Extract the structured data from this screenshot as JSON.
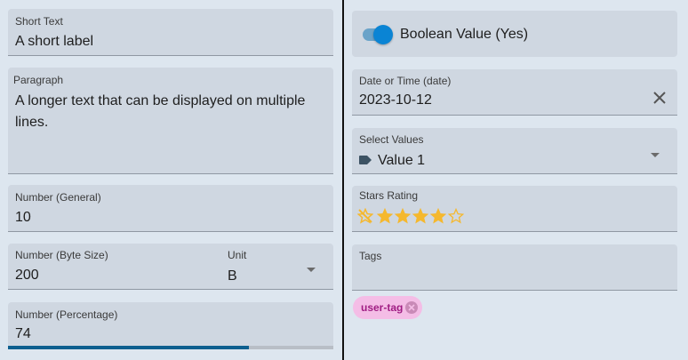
{
  "short_text": {
    "label": "Short Text",
    "value": "A short label"
  },
  "paragraph": {
    "label": "Paragraph",
    "value": "A longer text that can be displayed on multiple lines."
  },
  "number_general": {
    "label": "Number (General)",
    "value": "10"
  },
  "number_byte": {
    "label": "Number (Byte Size)",
    "value": "200",
    "unit_label": "Unit",
    "unit_value": "B"
  },
  "number_percentage": {
    "label": "Number (Percentage)",
    "value": "74",
    "progress_fraction": 0.74
  },
  "boolean": {
    "label": "Boolean Value (Yes)",
    "checked": true
  },
  "date": {
    "label": "Date or Time (date)",
    "value": "2023-10-12"
  },
  "select": {
    "label": "Select Values",
    "value": "Value 1"
  },
  "stars": {
    "label": "Stars Rating",
    "rating": 4,
    "max": 5
  },
  "tags": {
    "label": "Tags",
    "chips": [
      "user-tag"
    ]
  },
  "colors": {
    "accent": "#0a84d4",
    "progress": "#0d5f8f",
    "star": "#f5b82e",
    "chip_bg": "#f4bde6",
    "chip_text": "#a01e83"
  }
}
